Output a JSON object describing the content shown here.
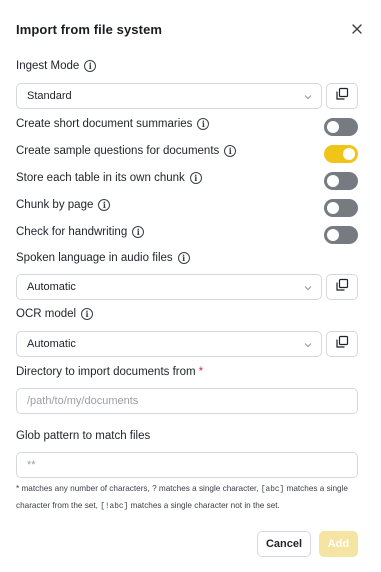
{
  "dialog": {
    "title": "Import from file system"
  },
  "ingest_mode": {
    "label": "Ingest Mode",
    "value": "Standard"
  },
  "toggles": [
    {
      "label": "Create short document summaries",
      "on": false
    },
    {
      "label": "Create sample questions for documents",
      "on": true
    },
    {
      "label": "Store each table in its own chunk",
      "on": false
    },
    {
      "label": "Chunk by page",
      "on": false
    },
    {
      "label": "Check for handwriting",
      "on": false
    }
  ],
  "spoken_language": {
    "label": "Spoken language in audio files",
    "value": "Automatic"
  },
  "ocr_model": {
    "label": "OCR model",
    "value": "Automatic"
  },
  "directory": {
    "label": "Directory to import documents from",
    "required_marker": "*",
    "placeholder": "/path/to/my/documents",
    "value": ""
  },
  "glob": {
    "label": "Glob pattern to match files",
    "placeholder": "**",
    "value": ""
  },
  "help": {
    "p1": "* matches any number of characters, ? matches a single character, ",
    "code1": "[abc]",
    "p2": " matches a single character from the set, ",
    "code2": "[!abc]",
    "p3": " matches a single character not in the set."
  },
  "buttons": {
    "cancel": "Cancel",
    "add": "Add"
  },
  "colors": {
    "toggle_on": "#f0c419",
    "toggle_off": "#767b82",
    "add_disabled": "#f6e4a3",
    "required": "#d6312b"
  },
  "icons": {
    "close": "close-icon",
    "info": "info-icon",
    "chevron": "chevron-down-icon",
    "copy": "copy-icon"
  }
}
